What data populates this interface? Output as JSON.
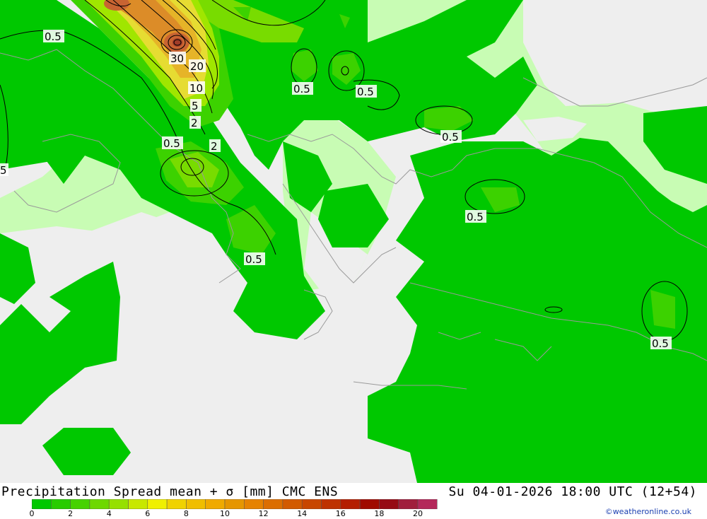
{
  "map": {
    "contour_labels": [
      "0.5",
      "30",
      "20",
      "10",
      "5",
      "2",
      "0.5",
      "2",
      "0.5",
      "0.5",
      "0.5",
      "0.5",
      "0.5",
      "0.5",
      "0.5",
      "5"
    ],
    "colors": {
      "no_data": "#eeeeee",
      "light": "#c8fcb4",
      "level_0": "#00c800",
      "level_1": "#3cd200",
      "level_2": "#78dc00",
      "level_3": "#a0e600",
      "level_4": "#e6dc32",
      "level_5": "#e6b428",
      "level_6": "#dc8c28",
      "level_7": "#c86432",
      "level_8": "#a03c28",
      "coastline": "#9a9a9a",
      "contour": "#000000"
    }
  },
  "footer": {
    "title": "Precipitation Spread mean + σ [mm] CMC ENS",
    "datetime": "Su 04-01-2026 18:00 UTC (12+54)",
    "credit": "©weatheronline.co.uk",
    "colorbar": {
      "ticks": [
        "0",
        "2",
        "4",
        "6",
        "8",
        "10",
        "12",
        "14",
        "16",
        "18",
        "20"
      ],
      "colors": [
        "#00c800",
        "#28cc00",
        "#46d200",
        "#6ed800",
        "#96e000",
        "#c8e800",
        "#f0f000",
        "#f0d200",
        "#f0be00",
        "#f0aa00",
        "#e69600",
        "#e68200",
        "#dc6e00",
        "#d25a00",
        "#c84600",
        "#be3200",
        "#b41e00",
        "#a00a00",
        "#960a14",
        "#a01e3c",
        "#b4285a"
      ]
    }
  }
}
